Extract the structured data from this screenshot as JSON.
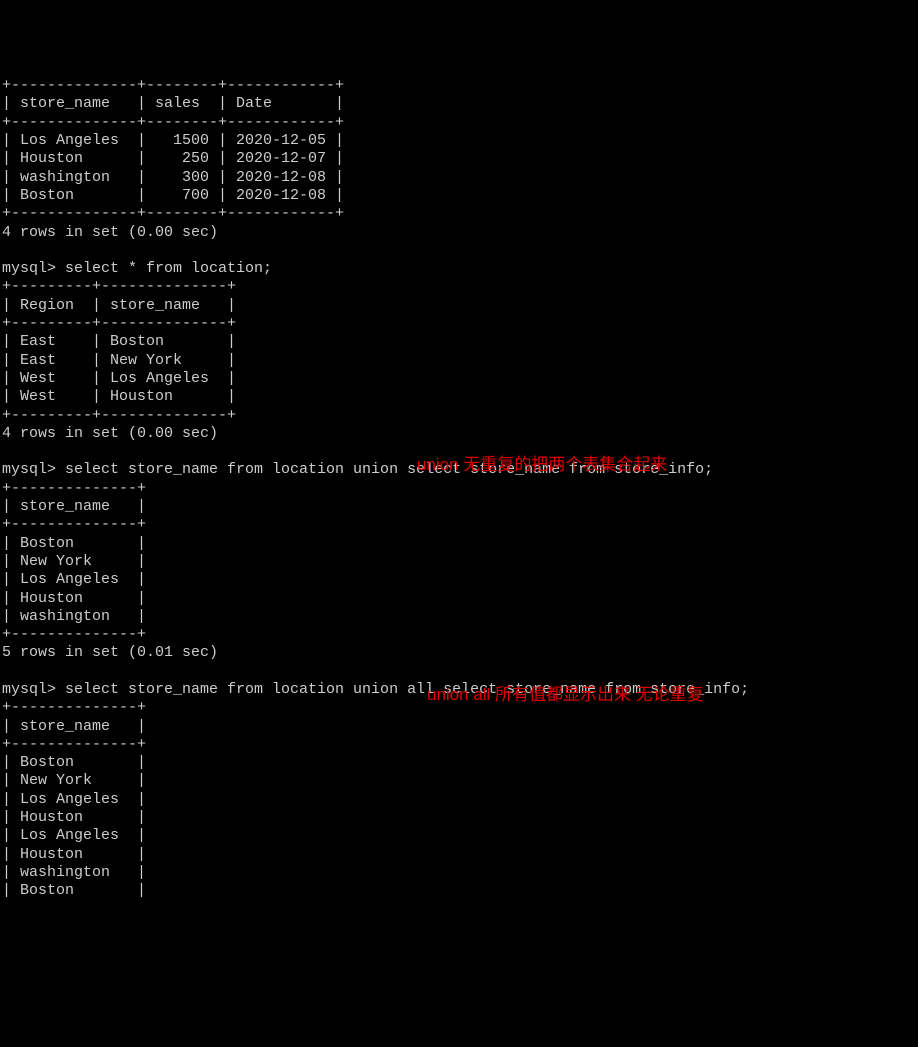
{
  "table1": {
    "cols": [
      "store_name",
      "sales",
      "Date"
    ],
    "rows": [
      [
        "Los Angeles",
        "1500",
        "2020-12-05"
      ],
      [
        "Houston",
        "250",
        "2020-12-07"
      ],
      [
        "washington",
        "300",
        "2020-12-08"
      ],
      [
        "Boston",
        "700",
        "2020-12-08"
      ]
    ],
    "footer": "4 rows in set (0.00 sec)"
  },
  "prompt": "mysql>",
  "query2": "select * from location;",
  "table2": {
    "cols": [
      "Region",
      "store_name"
    ],
    "rows": [
      [
        "East",
        "Boston"
      ],
      [
        "East",
        "New York"
      ],
      [
        "West",
        "Los Angeles"
      ],
      [
        "West",
        "Houston"
      ]
    ],
    "footer": "4 rows in set (0.00 sec)"
  },
  "query3": "select store_name from location union select store_name from store_info;",
  "table3": {
    "cols": [
      "store_name"
    ],
    "rows": [
      [
        "Boston"
      ],
      [
        "New York"
      ],
      [
        "Los Angeles"
      ],
      [
        "Houston"
      ],
      [
        "washington"
      ]
    ],
    "footer": "5 rows in set (0.01 sec)"
  },
  "annot1": "union 无重复的把两个表集合起来",
  "query4": "select store_name from location union all select store_name from store_info;",
  "table4": {
    "cols": [
      "store_name"
    ],
    "rows": [
      [
        "Boston"
      ],
      [
        "New York"
      ],
      [
        "Los Angeles"
      ],
      [
        "Houston"
      ],
      [
        "Los Angeles"
      ],
      [
        "Houston"
      ],
      [
        "washington"
      ],
      [
        "Boston"
      ]
    ]
  },
  "annot2": "union all 所有值都显示出来 无论重复"
}
